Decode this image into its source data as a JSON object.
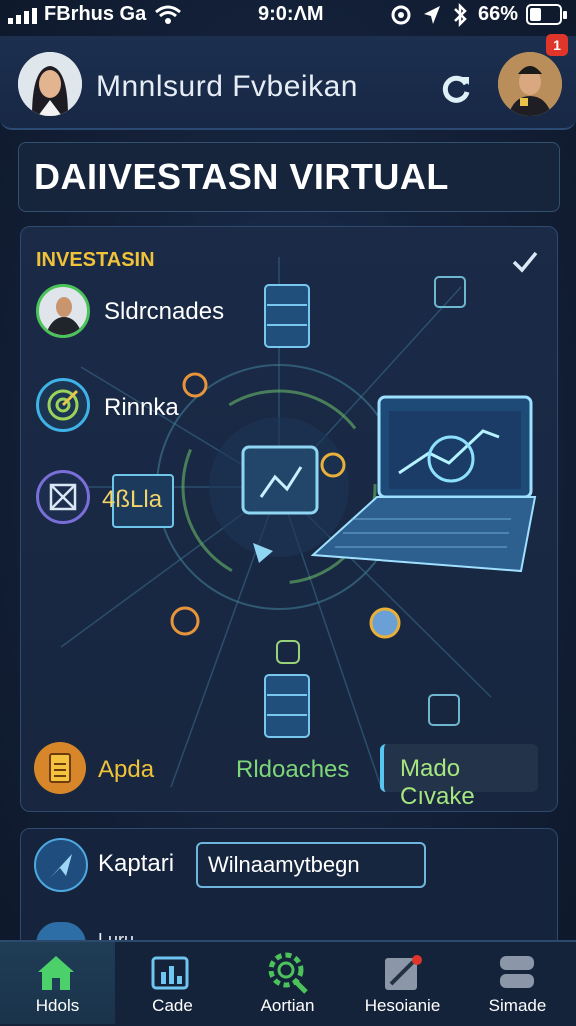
{
  "status_bar": {
    "carrier": "FBrhus Ga",
    "time": "9:0:ΛM",
    "battery": "66%"
  },
  "header": {
    "user_name": "Mnnlsurd Fvbeikan",
    "notification_count": "1"
  },
  "page_title": "DAIIVESTASN VIRTUAL",
  "card": {
    "section_label": "INVESTASIN",
    "items": [
      {
        "label": "Sldrcnades",
        "icon": "person-avatar"
      },
      {
        "label": "Rinnka",
        "icon": "target-icon"
      },
      {
        "label": "4ßLla",
        "icon": "map-icon"
      }
    ],
    "actions": [
      {
        "label": "Apda",
        "icon": "clipboard-icon"
      },
      {
        "label": "Rldoaches"
      },
      {
        "label": "Mado Cıvake"
      }
    ]
  },
  "search": {
    "label": "Kaptari",
    "value": "Wilnaamytbegn"
  },
  "partial_label": "Luru",
  "nav": [
    {
      "label": "Hdols",
      "icon": "home-icon",
      "active": true
    },
    {
      "label": "Cade",
      "icon": "chart-icon"
    },
    {
      "label": "Aortian",
      "icon": "gear-search-icon"
    },
    {
      "label": "Hesoianie",
      "icon": "edit-icon"
    },
    {
      "label": "Simade",
      "icon": "stack-icon"
    }
  ],
  "colors": {
    "accent": "#f0c23a",
    "active_nav": "#4cd06a",
    "cyan": "#58c6f0",
    "green": "#7ed67a"
  }
}
